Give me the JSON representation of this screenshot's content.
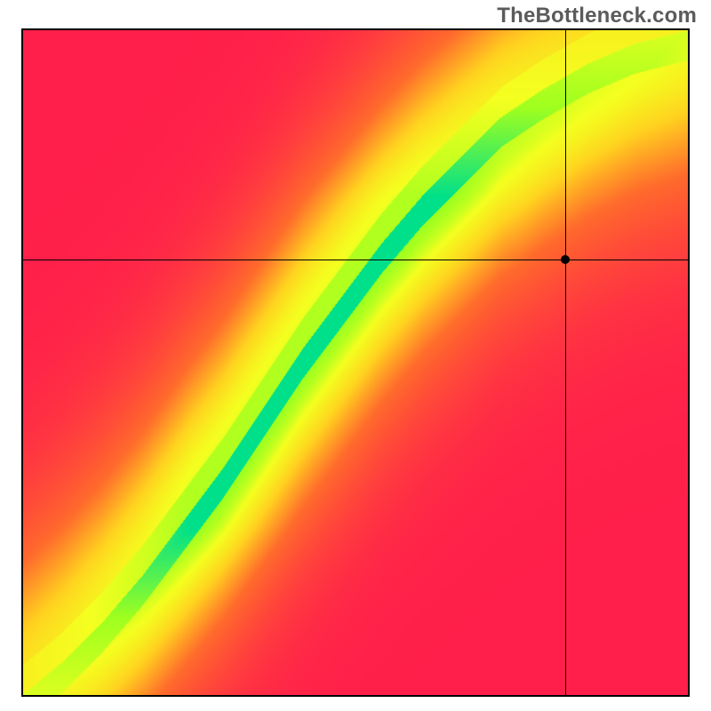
{
  "watermark": "TheBottleneck.com",
  "chart_data": {
    "type": "heatmap",
    "title": "",
    "xlabel": "",
    "ylabel": "",
    "xlim": [
      0,
      1
    ],
    "ylim": [
      0,
      1
    ],
    "grid": false,
    "legend": null,
    "colorscale": [
      {
        "stop": 0.0,
        "color": "#ff1f4a"
      },
      {
        "stop": 0.4,
        "color": "#ff6b2c"
      },
      {
        "stop": 0.65,
        "color": "#ffd21f"
      },
      {
        "stop": 0.82,
        "color": "#f4ff1f"
      },
      {
        "stop": 0.92,
        "color": "#9fff1f"
      },
      {
        "stop": 1.0,
        "color": "#00e08a"
      }
    ],
    "ridge": {
      "description": "Optimal CPU/GPU balance ridge; points are (x_norm, y_norm) in [0,1] with origin at bottom-left.",
      "points": [
        [
          0.0,
          0.0
        ],
        [
          0.06,
          0.05
        ],
        [
          0.12,
          0.11
        ],
        [
          0.18,
          0.18
        ],
        [
          0.24,
          0.26
        ],
        [
          0.3,
          0.34
        ],
        [
          0.36,
          0.43
        ],
        [
          0.42,
          0.52
        ],
        [
          0.48,
          0.6
        ],
        [
          0.54,
          0.68
        ],
        [
          0.6,
          0.75
        ],
        [
          0.66,
          0.81
        ],
        [
          0.72,
          0.87
        ],
        [
          0.78,
          0.91
        ],
        [
          0.85,
          0.95
        ],
        [
          0.92,
          0.98
        ],
        [
          1.0,
          1.0
        ]
      ],
      "half_width_norm": 0.045
    },
    "marker": {
      "x_norm": 0.815,
      "y_norm": 0.655,
      "label": ""
    }
  }
}
